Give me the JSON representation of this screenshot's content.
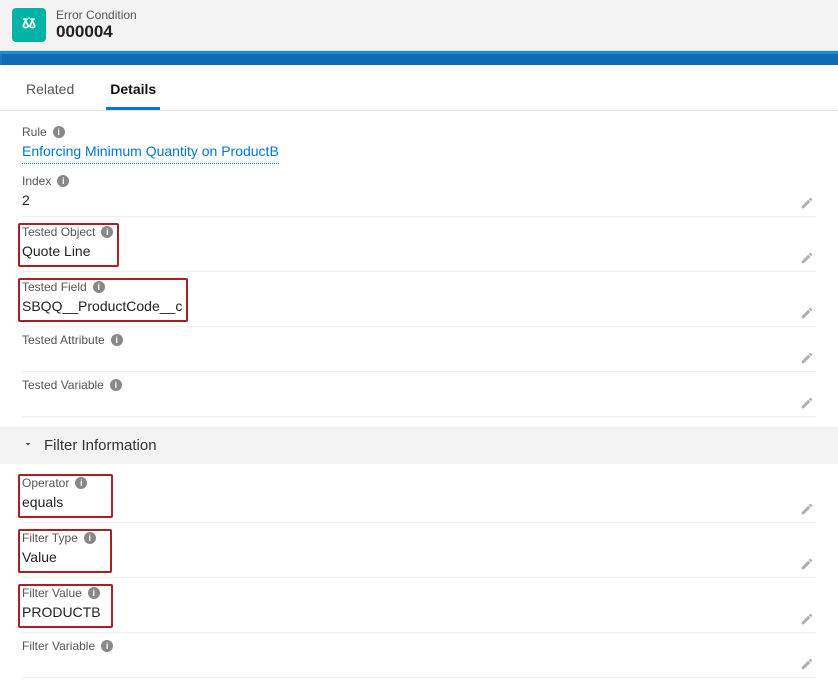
{
  "header": {
    "object_label": "Error Condition",
    "record_number": "000004"
  },
  "tabs": {
    "related": "Related",
    "details": "Details"
  },
  "fields": {
    "rule_label": "Rule",
    "rule_value": "Enforcing Minimum Quantity on ProductB",
    "index_label": "Index",
    "index_value": "2",
    "tested_object_label": "Tested Object",
    "tested_object_value": "Quote Line",
    "tested_field_label": "Tested Field",
    "tested_field_value": "SBQQ__ProductCode__c",
    "tested_attribute_label": "Tested Attribute",
    "tested_attribute_value": "",
    "tested_variable_label": "Tested Variable",
    "tested_variable_value": ""
  },
  "section": {
    "filter_information": "Filter Information"
  },
  "filter": {
    "operator_label": "Operator",
    "operator_value": "equals",
    "filter_type_label": "Filter Type",
    "filter_type_value": "Value",
    "filter_value_label": "Filter Value",
    "filter_value_value": "PRODUCTB",
    "filter_variable_label": "Filter Variable",
    "filter_variable_value": ""
  }
}
